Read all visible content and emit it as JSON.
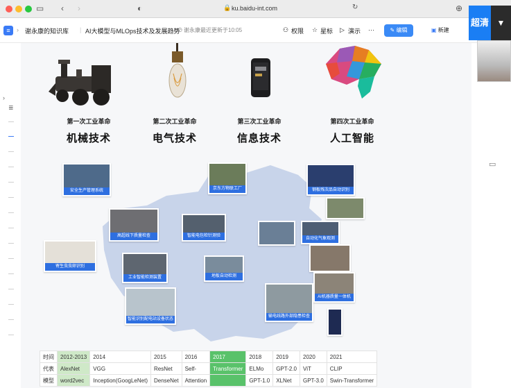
{
  "browser": {
    "url": "ku.baidu-int.com"
  },
  "app_bar": {
    "kb_name": "谢永康的知识库",
    "doc_title": "AI大模型与MLOps技术及发展趋势",
    "update_note": "谢永康最近更新于10:05",
    "permission": "权限",
    "star": "星标",
    "present": "演示",
    "more": "···",
    "edit": "编辑",
    "new": "新建"
  },
  "overlay": {
    "hd_label": "超清",
    "hd_arrow": "▼"
  },
  "eras": [
    {
      "sub": "第一次工业革命",
      "main": "机械技术"
    },
    {
      "sub": "第二次工业革命",
      "main": "电气技术"
    },
    {
      "sub": "第三次工业革命",
      "main": "信息技术"
    },
    {
      "sub": "第四次工业革命",
      "main": "人工智能"
    }
  ],
  "map_photos": [
    "安全生产管理系统",
    "京东方物联工厂",
    "钢板残次品自动识别",
    "高超线下质量检查",
    "智能电包检针测验",
    "自动化气象观测",
    "寄生虫虫卵识别",
    "工业智能检测装置",
    "地板自动检测",
    "AI机器质量一体机",
    "智能识别配电站设备状态",
    "输电线路外部隐患检查"
  ],
  "timeline": {
    "row_labels": [
      "时间",
      "代表",
      "模型"
    ],
    "years": [
      "2012-2013",
      "2014",
      "2015",
      "2016",
      "2017",
      "2018",
      "2019",
      "2020",
      "2021"
    ],
    "rep": [
      "AlexNet",
      "VGG",
      "ResNet",
      "Self-",
      "Transformer",
      "ELMo",
      "GPT-2.0",
      "ViT",
      "CLIP"
    ],
    "model": [
      "word2vec",
      "Inception(GoogLeNet)",
      "DenseNet",
      "Attention",
      "",
      "GPT-1.0",
      "XLNet",
      "GPT-3.0",
      "Swin-Transformer"
    ]
  }
}
